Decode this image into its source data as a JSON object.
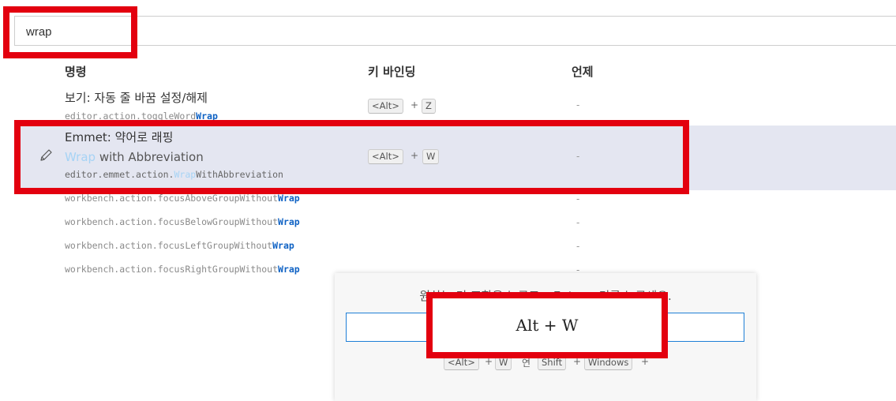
{
  "search": {
    "value": "wrap"
  },
  "columns": {
    "command": "명령",
    "keybinding": "키 바인딩",
    "when": "언제"
  },
  "rows": [
    {
      "title": "보기: 자동 줄 바꿈 설정/해제",
      "id_prefix": "editor.action.toggleWord",
      "id_match": "Wrap",
      "id_suffix": "",
      "keys": [
        "<Alt>",
        "Z"
      ],
      "when": "-"
    },
    {
      "title": "Emmet: 약어로 래핑",
      "subtitle_match": "Wrap",
      "subtitle_rest": " with Abbreviation",
      "id_prefix": "editor.emmet.action.",
      "id_match": "Wrap",
      "id_suffix": "WithAbbreviation",
      "keys": [
        "<Alt>",
        "W"
      ],
      "when": "-"
    },
    {
      "id_prefix": "workbench.action.focusAboveGroupWithout",
      "id_match": "Wrap",
      "when": "-"
    },
    {
      "id_prefix": "workbench.action.focusBelowGroupWithout",
      "id_match": "Wrap",
      "when": "-"
    },
    {
      "id_prefix": "workbench.action.focusLeftGroupWithout",
      "id_match": "Wrap",
      "when": "-"
    },
    {
      "id_prefix": "workbench.action.focusRightGroupWithout",
      "id_match": "Wrap",
      "when": "-"
    }
  ],
  "plus_sign": "+",
  "dialog": {
    "message": "원하는 키 조합을 누르고 <Enter> 키를 누르세요.",
    "input_text": "Alt + W",
    "hint": {
      "key1": "<Alt>",
      "key2": "W",
      "connector": "연",
      "key3": "Shift",
      "key4": "Windows",
      "plus": "+"
    }
  },
  "colors": {
    "highlight_red": "#e3000f",
    "selected_row": "#e4e6f1",
    "match_blue": "#0f62c4",
    "focus_border": "#1f7fd6"
  },
  "icons": {
    "edit": "pencil-icon"
  }
}
